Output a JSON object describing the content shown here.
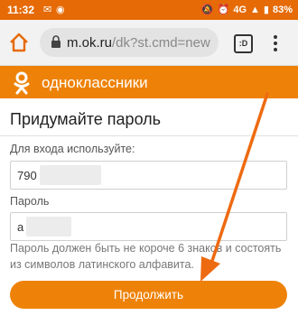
{
  "status_bar": {
    "time": "11:32",
    "network": "4G",
    "battery": "83%"
  },
  "browser": {
    "url_domain": "m.ok.ru",
    "url_path": "/dk?st.cmd=new",
    "tabs_label": ":D"
  },
  "header": {
    "site_name": "одноклассники"
  },
  "form": {
    "title": "Придумайте пароль",
    "login_label": "Для входа используйте:",
    "login_value": "790",
    "password_label": "Пароль",
    "password_value": "a",
    "hint": "Пароль должен быть не короче 6 знаков и состоять из символов латинского алфавита.",
    "continue_label": "Продолжить"
  },
  "colors": {
    "brand_orange": "#ee8208",
    "status_orange": "#e66a06"
  },
  "icons": [
    "home-icon",
    "lock-icon",
    "tabs-icon",
    "more-vert-icon",
    "ok-logo-icon"
  ]
}
